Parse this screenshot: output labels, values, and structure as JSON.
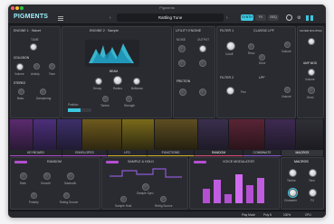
{
  "window": {
    "title": "Pigments"
  },
  "toolbar": {
    "brand": "PIGMENTS",
    "preset_name": "Rattling Tune",
    "btn_a": "SYNTH",
    "btn_b": "FX",
    "btn_c": "SEQ"
  },
  "engine1": {
    "title": "ENGINE 1 · Wavet",
    "tune_label": "TUNE",
    "collision_label": "COLLISION",
    "stereo_label": "STEREO",
    "knob_labels": [
      "Volume",
      "Anticip",
      "Tone",
      "Bass",
      "Dampening"
    ]
  },
  "engine2": {
    "title": "ENGINE 2 · Sample",
    "beam_label": "BEAM",
    "labels": [
      "Decay",
      "Radius",
      "Brilliance",
      "Timbre",
      "Strength",
      "Position"
    ]
  },
  "utility": {
    "title": "UTILITY ENGINE",
    "noise_label": "NOISE",
    "output_label": "OUTPUT",
    "friction_label": "FRICTION"
  },
  "filters": {
    "f1_title": "FILTER 1",
    "f1_type": "CLASSIC LPF",
    "f2_title": "FILTER 2",
    "f2_type": "LPF",
    "labels": [
      "Cutoff",
      "Reso",
      "Drive",
      "Volume",
      "Pan",
      "Filter Routing",
      "Amp Mod"
    ]
  },
  "amp": {
    "title": "FILTER ROUTING",
    "amp_label": "AMP MOD",
    "volume_label": "Volume",
    "send_label": "Send"
  },
  "tabs": [
    "KEYBOARD",
    "ENVELOPES",
    "LFO",
    "FUNCTIONS",
    "RANDOM",
    "COMBINATE",
    "MACROS"
  ],
  "mod": {
    "random_title": "RANDOM",
    "sample_title": "SAMPLE & HOLD",
    "voice_title": "VOICE MODULATOR",
    "labels": [
      "Rate",
      "Smooth",
      "Sawtooth",
      "Polarity",
      "Rating Source",
      "Sample Sync",
      "Sample Hold",
      "Retrig Source"
    ]
  },
  "macros": {
    "title": "MACROS",
    "labels": [
      "Timbre",
      "Time",
      "Character",
      "FX"
    ]
  },
  "bottombar": {
    "play_mode": "Play Mode",
    "poly": "Poly 8",
    "zoom": "100%",
    "cpu": "CPU"
  }
}
